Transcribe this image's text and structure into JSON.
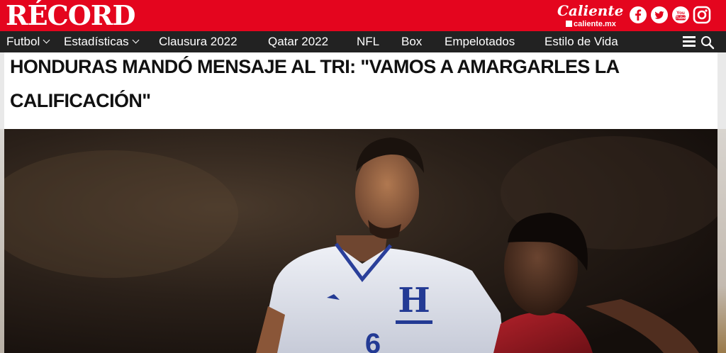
{
  "header": {
    "logo_text": "RÉCORD",
    "sponsor": {
      "name": "Caliente",
      "url": "caliente.mx"
    },
    "social": [
      {
        "icon": "facebook-icon"
      },
      {
        "icon": "twitter-icon"
      },
      {
        "icon": "youtube-icon",
        "text": "You Tube"
      },
      {
        "icon": "instagram-icon"
      }
    ],
    "brand_color": "#e4051e"
  },
  "nav": {
    "items": [
      {
        "label": "Futbol",
        "dropdown": true
      },
      {
        "label": "Estadísticas",
        "dropdown": true
      },
      {
        "label": "Clausura 2022",
        "dropdown": false
      },
      {
        "label": "Qatar 2022",
        "dropdown": false
      },
      {
        "label": "NFL",
        "dropdown": false
      },
      {
        "label": "Box",
        "dropdown": false
      },
      {
        "label": "Empelotados",
        "dropdown": false
      },
      {
        "label": "Estilo de Vida",
        "dropdown": false
      }
    ],
    "menu_icon": "hamburger-menu-icon",
    "search_icon": "search-icon",
    "background": "#222222"
  },
  "article": {
    "headline": "HONDURAS MANDÓ MENSAJE AL TRI: \"VAMOS A AMARGARLES LA CALIFICACIÓN\"",
    "photo": {
      "jersey_letter": "H",
      "jersey_number": "6"
    }
  }
}
